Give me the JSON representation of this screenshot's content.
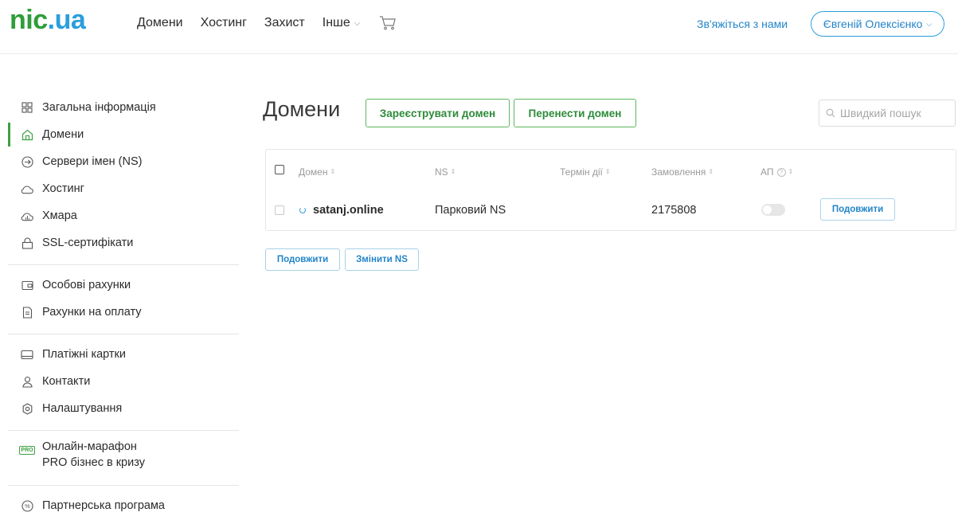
{
  "header": {
    "logo_nic": "nic",
    "logo_dot_ua": ".ua",
    "nav": [
      {
        "label": "Домени"
      },
      {
        "label": "Хостинг"
      },
      {
        "label": "Захист"
      },
      {
        "label": "Інше"
      }
    ],
    "contact_label": "Зв'яжіться з нами",
    "user_name": "Євгеній Олексієнко"
  },
  "sidebar": {
    "items": [
      {
        "label": "Загальна інформація",
        "icon": "grid-icon"
      },
      {
        "label": "Домени",
        "icon": "home-icon",
        "active": true
      },
      {
        "label": "Сервери імен (NS)",
        "icon": "arrow-circle-icon"
      },
      {
        "label": "Хостинг",
        "icon": "cloud-icon"
      },
      {
        "label": "Хмара",
        "icon": "cloud-chart-icon"
      },
      {
        "label": "SSL-сертифікати",
        "icon": "lock-icon"
      },
      {
        "label": "Особові рахунки",
        "icon": "wallet-icon"
      },
      {
        "label": "Рахунки на оплату",
        "icon": "document-icon"
      },
      {
        "label": "Платіжні картки",
        "icon": "card-icon"
      },
      {
        "label": "Контакти",
        "icon": "person-icon"
      },
      {
        "label": "Налаштування",
        "icon": "gear-icon"
      },
      {
        "label_line1": "Онлайн-марафон",
        "label_line2": "PRO бізнес в кризу",
        "icon": "pro-badge-icon",
        "badge": "PRO"
      },
      {
        "label": "Партнерська програма",
        "icon": "percent-icon"
      }
    ]
  },
  "main": {
    "title": "Домени",
    "register_button": "Зареєструвати домен",
    "transfer_button": "Перенести домен",
    "search_placeholder": "Швидкий пошук",
    "table": {
      "headers": {
        "domain": "Домен",
        "ns": "NS",
        "term": "Термін дії",
        "order": "Замовлення",
        "ap": "АП",
        "ap_help": "?"
      },
      "rows": [
        {
          "domain": "satanj.online",
          "ns": "Парковий NS",
          "term": "",
          "order": "2175808",
          "auto_renew": false,
          "renew_button": "Подовжити"
        }
      ]
    },
    "bulk_renew_button": "Подовжити",
    "bulk_change_ns_button": "Змінити NS"
  }
}
